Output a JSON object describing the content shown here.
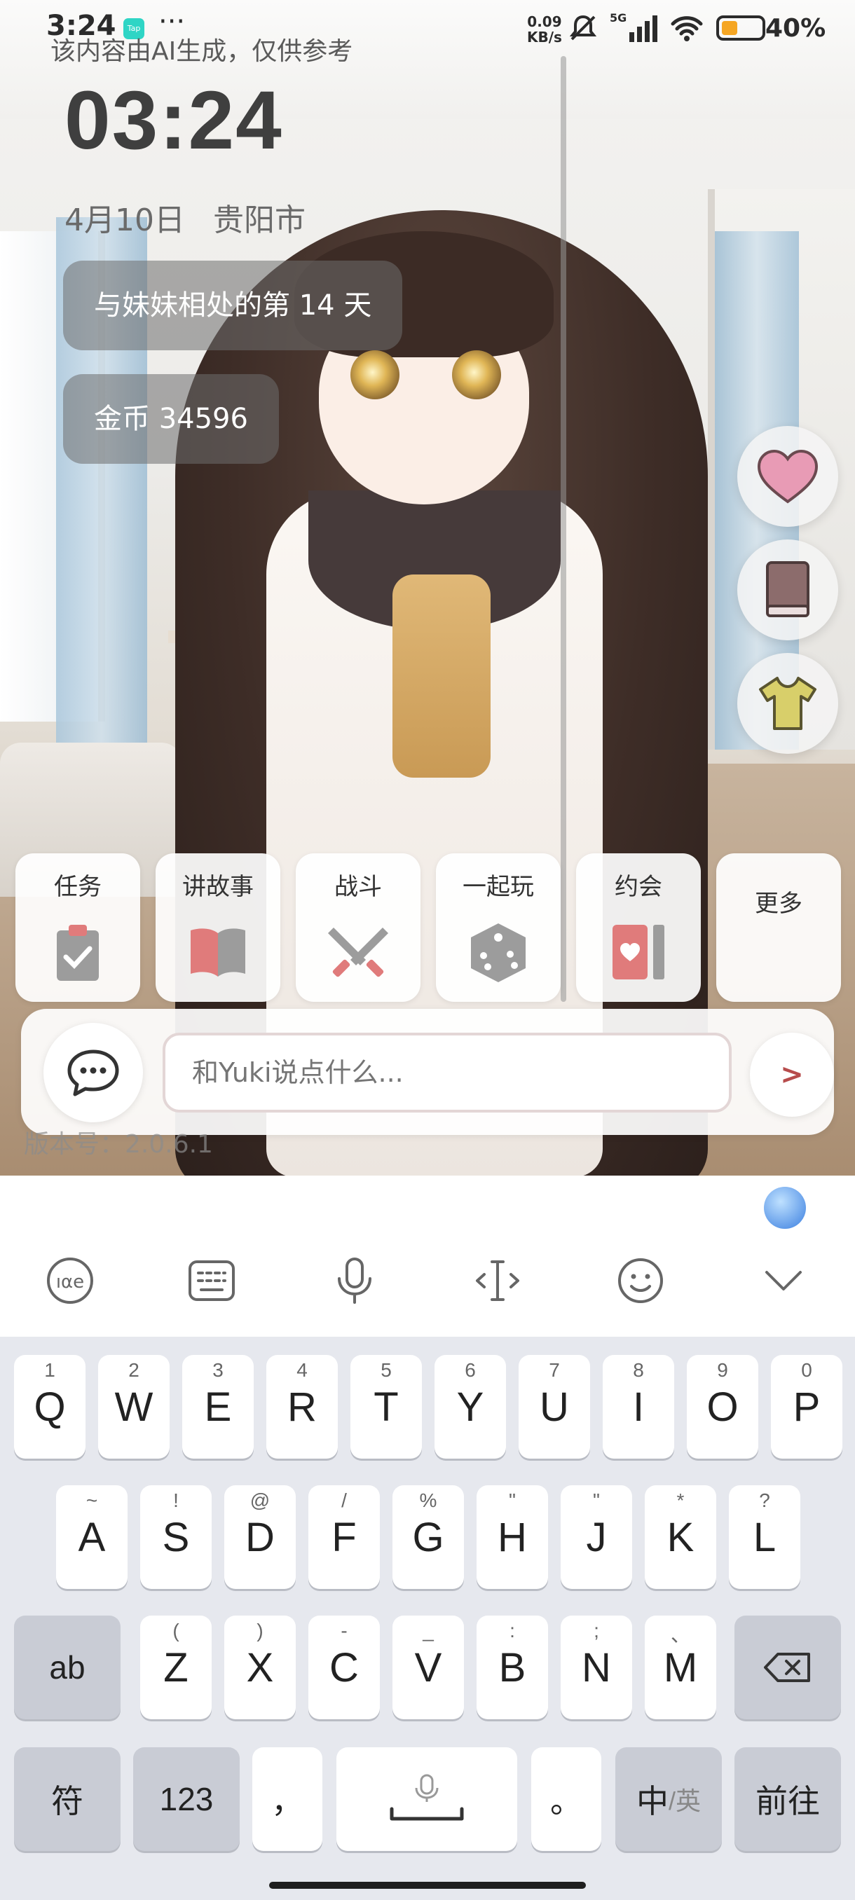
{
  "status_bar": {
    "time": "3:24",
    "app_badge": "Tap",
    "more": "···",
    "net_speed_value": "0.09",
    "net_speed_unit": "KB/s",
    "signal_label": "5G",
    "battery_percent": "40%",
    "battery_level": 0.4,
    "battery_color": "#f5a623"
  },
  "ai_notice": "该内容由AI生成，仅供参考",
  "overlay": {
    "clock": "03:24",
    "date": "4月10日",
    "city": "贵阳市",
    "days_together": "与妹妹相处的第 14 天",
    "coins": "金币 34596"
  },
  "side_buttons": [
    {
      "icon": "heart-icon",
      "color": "#e89bb5"
    },
    {
      "icon": "book-icon",
      "color": "#8c6c6c"
    },
    {
      "icon": "shirt-icon",
      "color": "#d8cf6a"
    }
  ],
  "actions": [
    {
      "label": "任务",
      "icon": "clipboard-check-icon"
    },
    {
      "label": "讲故事",
      "icon": "open-book-icon"
    },
    {
      "label": "战斗",
      "icon": "crossed-swords-icon"
    },
    {
      "label": "一起玩",
      "icon": "dice-icon"
    },
    {
      "label": "约会",
      "icon": "heart-card-icon"
    },
    {
      "label": "更多",
      "icon": ""
    }
  ],
  "chat": {
    "placeholder": "和Yuki说点什么...",
    "send_label": ">"
  },
  "version": "版本号：2.0.6.1",
  "keyboard": {
    "toolbar": [
      "ime-logo-icon",
      "keyboard-layout-icon",
      "microphone-icon",
      "cursor-icon",
      "emoji-icon",
      "collapse-chevron-icon"
    ],
    "row1": [
      {
        "k": "Q",
        "h": "1"
      },
      {
        "k": "W",
        "h": "2"
      },
      {
        "k": "E",
        "h": "3"
      },
      {
        "k": "R",
        "h": "4"
      },
      {
        "k": "T",
        "h": "5"
      },
      {
        "k": "Y",
        "h": "6"
      },
      {
        "k": "U",
        "h": "7"
      },
      {
        "k": "I",
        "h": "8"
      },
      {
        "k": "O",
        "h": "9"
      },
      {
        "k": "P",
        "h": "0"
      }
    ],
    "row2": [
      {
        "k": "A",
        "h": "~"
      },
      {
        "k": "S",
        "h": "!"
      },
      {
        "k": "D",
        "h": "@"
      },
      {
        "k": "F",
        "h": "/"
      },
      {
        "k": "G",
        "h": "%"
      },
      {
        "k": "H",
        "h": "\""
      },
      {
        "k": "J",
        "h": "\""
      },
      {
        "k": "K",
        "h": "*"
      },
      {
        "k": "L",
        "h": "?"
      }
    ],
    "row3": [
      {
        "k": "Z",
        "h": "("
      },
      {
        "k": "X",
        "h": ")"
      },
      {
        "k": "C",
        "h": "-"
      },
      {
        "k": "V",
        "h": "_"
      },
      {
        "k": "B",
        "h": ":"
      },
      {
        "k": "N",
        "h": ";"
      },
      {
        "k": "M",
        "h": "、"
      }
    ],
    "ab_label": "ab",
    "symbol_label": "符",
    "num_label": "123",
    "comma_label": "，",
    "period_label": "。",
    "zh_label": "中",
    "en_label": "/英",
    "go_label": "前往"
  }
}
